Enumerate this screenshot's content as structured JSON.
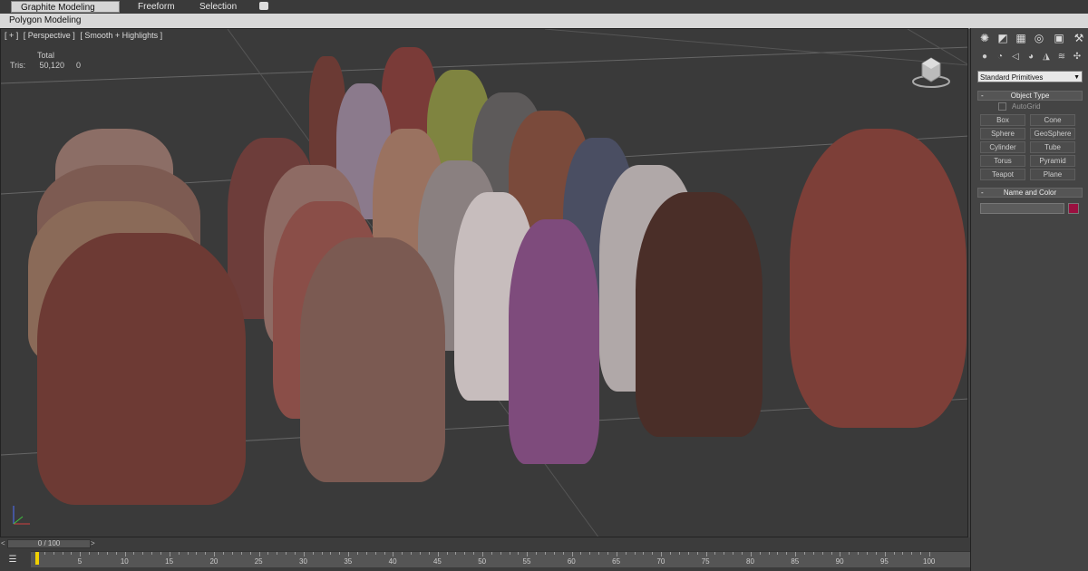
{
  "ribbon": {
    "tabs": [
      {
        "label": "Graphite Modeling Tools",
        "active": true
      },
      {
        "label": "Freeform",
        "active": false
      },
      {
        "label": "Selection",
        "active": false
      }
    ],
    "panel_label": "Polygon Modeling"
  },
  "viewport": {
    "labels": [
      "[ + ]",
      "[ Perspective ]",
      "[ Smooth + Highlights ]"
    ],
    "stats": {
      "header": "Total",
      "row_label": "Tris:",
      "value": "50,120",
      "sel": "0"
    },
    "viewcube_icon": "viewcube-icon"
  },
  "command_panel": {
    "tab_icons": [
      "sun-icon",
      "modify-icon",
      "hierarchy-icon",
      "motion-icon",
      "display-icon",
      "hammer-icon"
    ],
    "category_icons": [
      "geometry-icon",
      "shapes-icon",
      "lights-icon",
      "cameras-icon",
      "helpers-icon",
      "spacewarps-icon",
      "systems-icon"
    ],
    "dropdown": "Standard Primitives",
    "object_type_title": "Object Type",
    "autogrid": "AutoGrid",
    "buttons": [
      "Box",
      "Cone",
      "Sphere",
      "GeoSphere",
      "Cylinder",
      "Tube",
      "Torus",
      "Pyramid",
      "Teapot",
      "Plane"
    ],
    "name_color_title": "Name and Color",
    "swatch_color": "#9a1040"
  },
  "timeline": {
    "slider_text": "0 / 100",
    "ticks": [
      "5",
      "10",
      "15",
      "20",
      "25",
      "30",
      "35",
      "40",
      "45",
      "50",
      "55",
      "60",
      "65",
      "70",
      "75",
      "80",
      "85",
      "90",
      "95",
      "100"
    ]
  }
}
